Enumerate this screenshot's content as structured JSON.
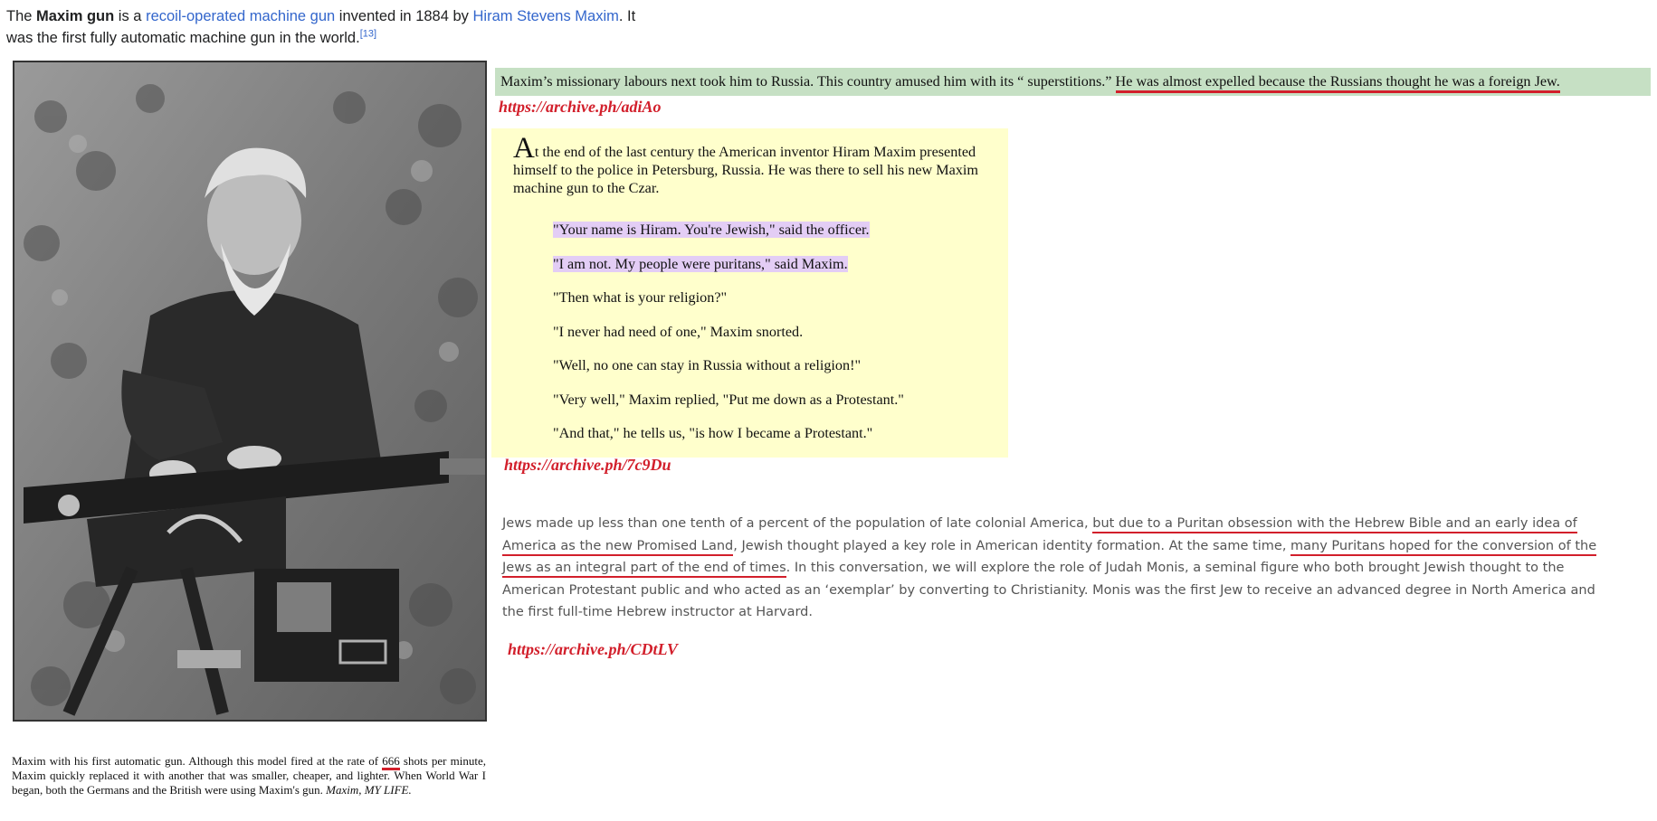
{
  "wiki_snippet": {
    "part1": "The ",
    "bold": "Maxim gun",
    "part2": " is a ",
    "link1": "recoil-operated machine gun",
    "part3": " invented in 1884 by ",
    "link2": "Hiram Stevens Maxim",
    "part4": ". It was the first fully automatic machine gun in the world.",
    "citation": "[13]"
  },
  "photo_caption": {
    "pre": "Maxim with his first automatic gun. Although this model fired at the rate of ",
    "underlined": "666",
    "post": " shots per minute, Maxim quickly replaced it with another that was smaller, cheaper, and lighter. When World War I began, both the Germans and the British were using Maxim's gun. ",
    "source": "Maxim, MY LIFE."
  },
  "green_bar": {
    "plain": "Maxim’s missionary labours next took him to Russia. This country amused him with its “ superstitions.” ",
    "underlined": "He was almost expelled because the Russians thought he was a foreign Jew."
  },
  "links": {
    "link1": "https://archive.ph/adiAo",
    "link2": "https://archive.ph/7c9Du",
    "link3": "https://archive.ph/CDtLV"
  },
  "yellow_box": {
    "dropcap": "A",
    "intro": "t the end of the last century the American inventor Hiram Maxim presented himself to the police in Petersburg, Russia. He was there to sell his new Maxim machine gun to the Czar.",
    "dialog": [
      "\"Your name is Hiram. You're Jewish,\" said the officer.",
      "\"I am not. My people were puritans,\" said Maxim.",
      "\"Then what is your religion?\"",
      "\"I never had need of one,\" Maxim snorted.",
      "\"Well, no one can stay in Russia without a religion!\"",
      "\"Very well,\" Maxim replied, \"Put me down as a Protestant.\"",
      "\"And that,\" he tells us, \"is how I became a Protestant.\""
    ]
  },
  "gray_para": {
    "p1": "Jews made up less than one tenth of a percent of the population of late colonial America, ",
    "u1": "but due to a Puritan obsession with the Hebrew Bible and an early idea of America as the new Promised Land",
    "p2": ", Jewish thought played a key role in American identity formation. At the same time, ",
    "u2": "many Puritans hoped for the conversion of the Jews as an integral part of the end of times",
    "p3": ". In this conversation, we will explore the role of Judah Monis, a seminal figure who both brought Jewish thought to the American Protestant public and who acted as an ‘exemplar’ by converting to Christianity. Monis was the first Jew to receive an advanced degree in North America and the first full-time Hebrew instructor at Harvard."
  }
}
